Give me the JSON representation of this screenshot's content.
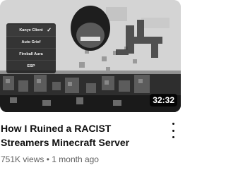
{
  "thumbnail": {
    "mod_menu": {
      "items": [
        {
          "label": "Kanye Client",
          "checked": true
        },
        {
          "label": "Auto Grief",
          "checked": false
        },
        {
          "label": "Fireball Aura",
          "checked": false
        },
        {
          "label": "ESP",
          "checked": false
        }
      ],
      "check_glyph": "✓"
    },
    "duration": "32:32"
  },
  "video": {
    "title": "How I Ruined a RACIST Streamers Minecraft Server",
    "views": "751K views",
    "separator": "•",
    "age": "1 month ago"
  },
  "icons": {
    "menu": "more-vert-icon"
  }
}
